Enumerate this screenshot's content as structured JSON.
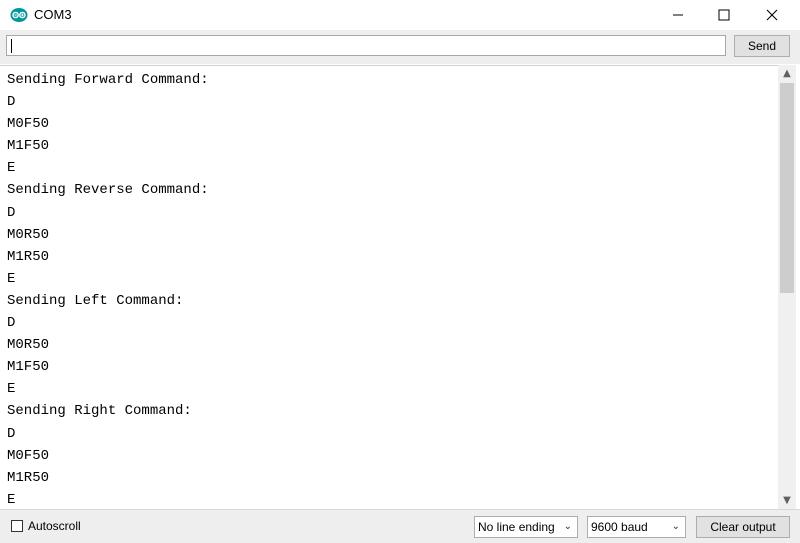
{
  "window": {
    "title": "COM3",
    "accent_color": "#00979c"
  },
  "input": {
    "value": "",
    "send_label": "Send"
  },
  "output": {
    "lines": [
      "Sending Forward Command:",
      "D",
      "M0F50",
      "M1F50",
      "E",
      "Sending Reverse Command:",
      "D",
      "M0R50",
      "M1R50",
      "E",
      "Sending Left Command:",
      "D",
      "M0R50",
      "M1F50",
      "E",
      "Sending Right Command:",
      "D",
      "M0F50",
      "M1R50",
      "E"
    ]
  },
  "footer": {
    "autoscroll_label": "Autoscroll",
    "autoscroll_checked": false,
    "line_ending": "No line ending",
    "baud_rate": "9600 baud",
    "clear_label": "Clear output"
  }
}
